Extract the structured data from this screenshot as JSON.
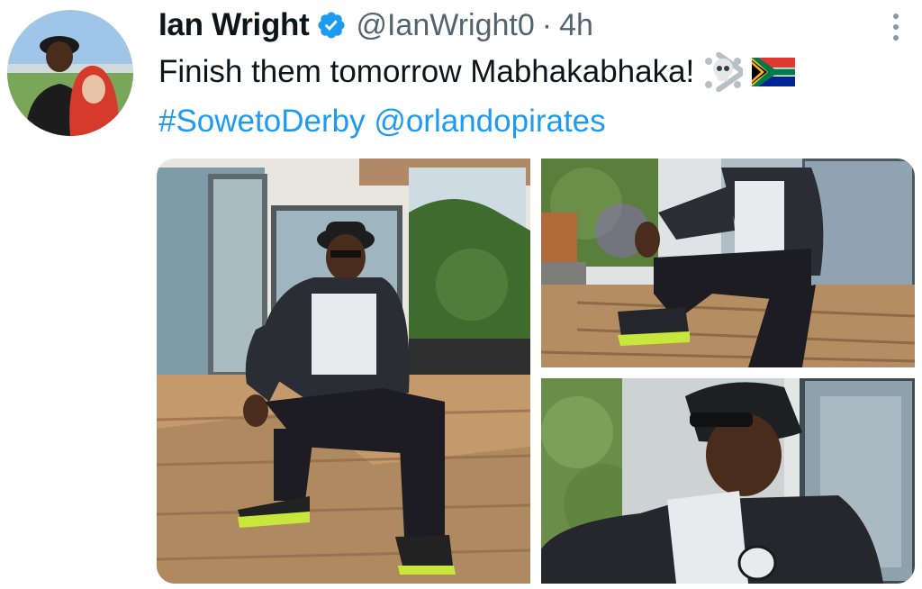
{
  "tweet": {
    "author_name": "Ian Wright",
    "handle": "@IanWright0",
    "separator": "·",
    "time": "4h",
    "text_line1": "Finish them tomorrow Mabhakabhaka!",
    "hashtag": "#SowetoDerby",
    "mention": "@orlandopirates",
    "emojis": [
      "skull-and-crossbones-emoji",
      "south-africa-flag-emoji"
    ],
    "verified_icon": "verified-badge-icon",
    "more_icon": "more-options-icon"
  },
  "media": {
    "photos": [
      {
        "name": "photo-1",
        "description_icon": "man-seated-on-deck-full"
      },
      {
        "name": "photo-2",
        "description_icon": "man-seated-on-deck-closeup"
      },
      {
        "name": "photo-3",
        "description_icon": "man-in-bucket-hat-portrait"
      }
    ]
  },
  "colors": {
    "link": "#1d9bf0",
    "verified": "#1d9bf0",
    "text": "#0f1419",
    "secondary": "#536471"
  }
}
